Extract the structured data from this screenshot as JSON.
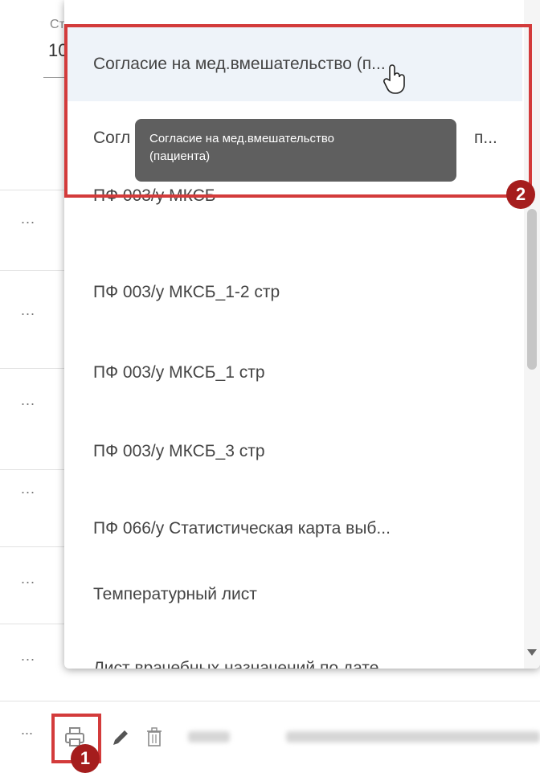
{
  "background": {
    "field_label": "Ст",
    "field_value": "10",
    "row_menu_label": "..."
  },
  "dropdown": {
    "options": [
      {
        "label": "Согласие на мед.вмешательство (п...",
        "active": true
      },
      {
        "label": "Согл",
        "trailing": "п..."
      },
      {
        "label": "ПФ 003/у МКСБ"
      },
      {
        "label": "ПФ 003/у МКСБ_1-2 стр"
      },
      {
        "label": "ПФ 003/у МКСБ_1 стр"
      },
      {
        "label": "ПФ 003/у МКСБ_3 стр"
      },
      {
        "label": "ПФ 066/у Статистическая карта выб..."
      },
      {
        "label": "Температурный лист"
      },
      {
        "label": "Лист врачебных назначений по дате"
      }
    ]
  },
  "tooltip": {
    "line1": "Согласие на мед.вмешательство",
    "line2": "(пациента)"
  },
  "markers": {
    "step1": "1",
    "step2": "2"
  },
  "toolbar": {
    "more_label": "..."
  },
  "colors": {
    "highlight": "#d33b3b",
    "marker": "#a51d1d",
    "tooltip_bg": "#5f5f5f",
    "active_option_bg": "#eef3f9"
  }
}
